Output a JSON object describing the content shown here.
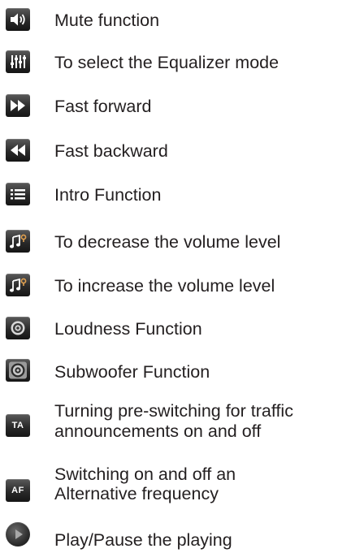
{
  "items": [
    {
      "icon": "speaker-volume-icon",
      "label": "Mute function"
    },
    {
      "icon": "equalizer-sliders-icon",
      "label": "To select the Equalizer mode"
    },
    {
      "icon": "fast-forward-icon",
      "label": "Fast forward"
    },
    {
      "icon": "fast-backward-icon",
      "label": "Fast backward"
    },
    {
      "icon": "list-icon",
      "label": "Intro Function"
    },
    {
      "icon": "music-note-volume-down-icon",
      "label": "To decrease the volume level"
    },
    {
      "icon": "music-note-volume-up-icon",
      "label": "To increase the volume level"
    },
    {
      "icon": "loudness-circle-icon",
      "label": "Loudness Function"
    },
    {
      "icon": "subwoofer-speaker-icon",
      "label": "Subwoofer Function"
    },
    {
      "icon": "ta-badge-icon",
      "icon_text": "TA",
      "label_line1": "Turning pre-switching for traffic",
      "label_line2": "announcements on and off"
    },
    {
      "icon": "af-badge-icon",
      "icon_text": "AF",
      "label_line1": "Switching on and off an",
      "label_line2": "Alternative frequency"
    },
    {
      "icon": "play-pause-icon",
      "label": "Play/Pause the playing"
    }
  ]
}
